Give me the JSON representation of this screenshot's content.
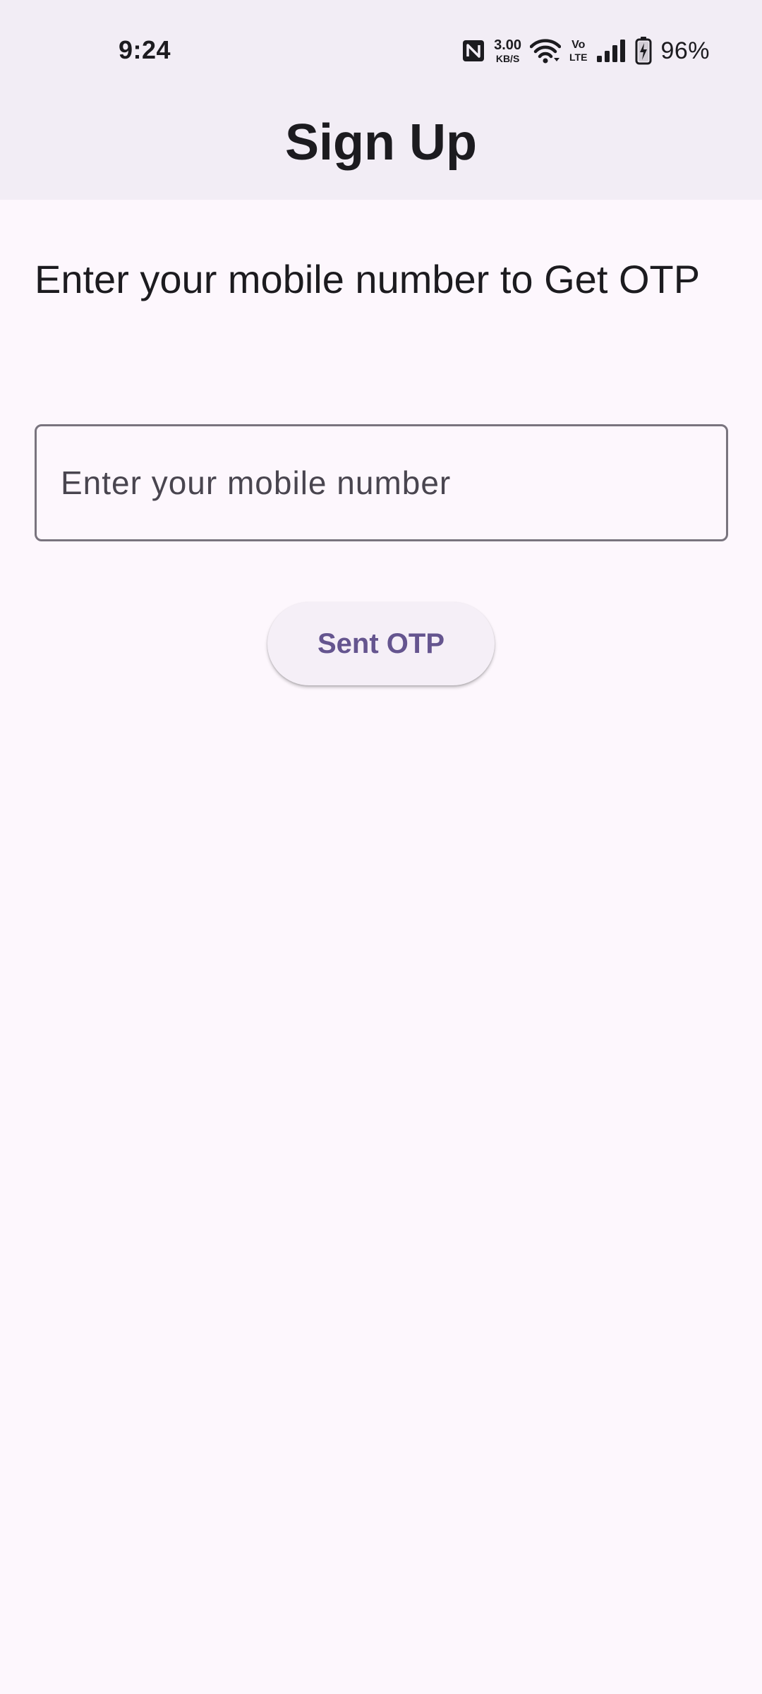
{
  "status_bar": {
    "time": "9:24",
    "net_speed_value": "3.00",
    "net_speed_unit": "KB/S",
    "volte_label_top": "Vo",
    "volte_label_bottom": "LTE",
    "battery_percent": "96%",
    "icons": [
      "nfc-icon",
      "wifi-icon",
      "volte-icon",
      "signal-icon",
      "battery-charging-icon"
    ]
  },
  "app_bar": {
    "title": "Sign Up"
  },
  "form": {
    "prompt": "Enter your mobile number to Get OTP",
    "mobile_value": "",
    "mobile_placeholder": "Enter your mobile number",
    "submit_label": "Sent OTP"
  },
  "colors": {
    "app_bar_bg": "#f2edf5",
    "page_bg": "#fdf7fd",
    "button_text": "#65558f",
    "field_border": "#79747e"
  }
}
